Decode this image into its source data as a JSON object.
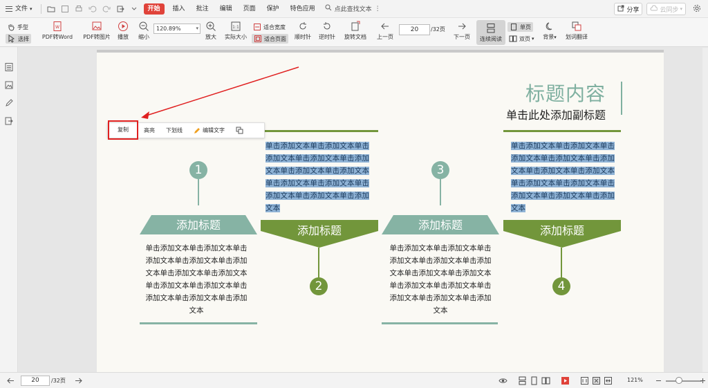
{
  "menubar": {
    "file": "文件",
    "tabs": [
      {
        "label": "开始",
        "active": true
      },
      {
        "label": "插入"
      },
      {
        "label": "批注"
      },
      {
        "label": "编辑"
      },
      {
        "label": "页面"
      },
      {
        "label": "保护"
      },
      {
        "label": "特色应用"
      }
    ],
    "search_label": "点此查找文本",
    "share": "分享",
    "cloud_sync": "云同步"
  },
  "toolbar": {
    "hand": "手型",
    "select": "选择",
    "pdf_to_word": "PDF转Word",
    "pdf_to_image": "PDF转图片",
    "play": "播放",
    "zoom_out": "缩小",
    "zoom_value": "120.89%",
    "fit_width": "适合宽度",
    "fit_page": "适合页面",
    "zoom_in": "放大",
    "actual_size": "实际大小",
    "rotate_cw": "顺时针",
    "rotate_ccw": "逆时针",
    "rotate_doc": "旋转文档",
    "prev_page": "上一页",
    "page_current": "20",
    "page_total": "/32页",
    "next_page": "下一页",
    "continuous": "连续阅读",
    "single_page": "单页",
    "double_page": "双页",
    "background": "背景",
    "translate": "划词翻译"
  },
  "popup": {
    "copy": "复制",
    "highlight": "高亮",
    "underline": "下划线",
    "edit_text": "编辑文字"
  },
  "slide": {
    "title": "标题内容",
    "subtitle": "单击此处添加副标题",
    "cards": [
      {
        "number": "1",
        "heading": "添加标题",
        "text": "单击添加文本单击添加文本单击添加文本单击添加文本单击添加文本单击添加文本单击添加文本单击添加文本单击添加文本单击添加文本单击添加文本单击添加文本"
      },
      {
        "number": "2",
        "heading": "添加标题",
        "text": "单击添加文本单击添加文本单击添加文本单击添加文本单击添加文本单击添加文本单击添加文本单击添加文本单击添加文本单击添加文本单击添加文本单击添加文本"
      },
      {
        "number": "3",
        "heading": "添加标题",
        "text": "单击添加文本单击添加文本单击添加文本单击添加文本单击添加文本单击添加文本单击添加文本单击添加文本单击添加文本单击添加文本单击添加文本单击添加文本"
      },
      {
        "number": "4",
        "heading": "添加标题",
        "text": "单击添加文本单击添加文本单击添加文本单击添加文本单击添加文本单击添加文本单击添加文本单击添加文本单击添加文本单击添加文本单击添加文本单击添加文本"
      }
    ]
  },
  "statusbar": {
    "page_current": "20",
    "page_total": "/32页",
    "zoom": "121%"
  },
  "colors": {
    "accent_red": "#e0433a",
    "green": "#72963b",
    "teal": "#86b3a4",
    "highlight": "#8fb3d6"
  }
}
